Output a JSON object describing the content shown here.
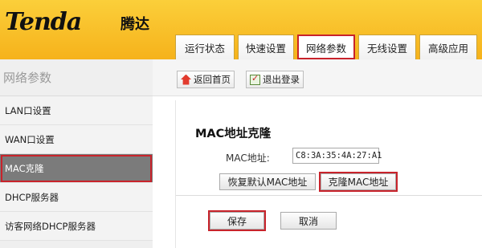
{
  "header": {
    "logo": "Tenda",
    "logo_cn": "腾达",
    "tabs": [
      {
        "label": "运行状态"
      },
      {
        "label": "快速设置"
      },
      {
        "label": "网络参数"
      },
      {
        "label": "无线设置"
      },
      {
        "label": "高级应用"
      }
    ],
    "active_tab": "网络参数"
  },
  "sidebar": {
    "title": "网络参数",
    "items": [
      {
        "label": "LAN口设置"
      },
      {
        "label": "WAN口设置"
      },
      {
        "label": "MAC克隆"
      },
      {
        "label": "DHCP服务器"
      },
      {
        "label": "访客网络DHCP服务器"
      }
    ],
    "active_item": "MAC克隆"
  },
  "toolbar": {
    "home_label": "返回首页",
    "logout_label": "退出登录"
  },
  "main": {
    "section_title": "MAC地址克隆",
    "mac_label": "MAC地址:",
    "mac_value": "C8:3A:35:4A:27:A1",
    "restore_default_label": "恢复默认MAC地址",
    "clone_label": "克隆MAC地址",
    "save_label": "保存",
    "cancel_label": "取消"
  },
  "colors": {
    "header_yellow": "#f6b21b",
    "highlight_red": "#c8232b",
    "sidebar_active": "#7b7b7b"
  }
}
